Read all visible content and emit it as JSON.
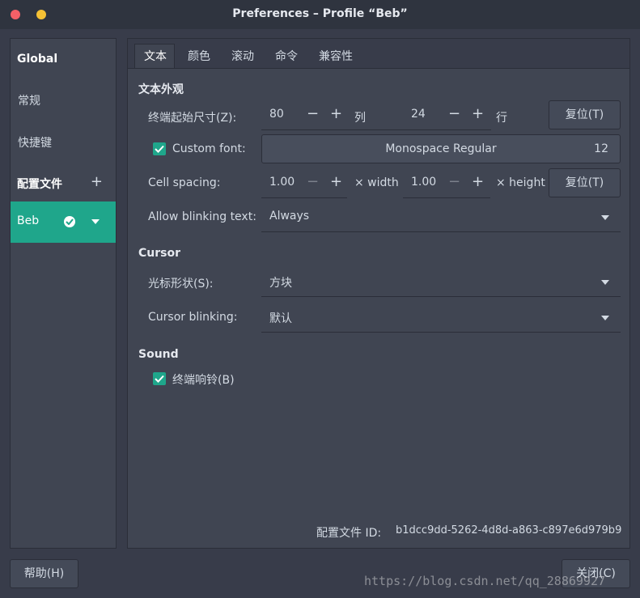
{
  "window": {
    "title": "Preferences – Profile “Beb”"
  },
  "sidebar": {
    "global": "Global",
    "general": "常规",
    "shortcuts": "快捷键",
    "profiles_header": "配置文件",
    "add_symbol": "+",
    "active_profile": "Beb"
  },
  "tabs": [
    "文本",
    "颜色",
    "滚动",
    "命令",
    "兼容性"
  ],
  "text_tab": {
    "appearance_header": "文本外观",
    "initial_size_label": "终端起始尺寸(Z):",
    "columns_value": "80",
    "columns_unit": "列",
    "rows_value": "24",
    "rows_unit": "行",
    "reset_label": "复位(T)",
    "custom_font_label": "Custom font:",
    "custom_font_checked": true,
    "font_name": "Monospace Regular",
    "font_size": "12",
    "cell_spacing_label": "Cell spacing:",
    "width_value": "1.00",
    "width_unit": "× width",
    "height_value": "1.00",
    "height_unit": "× height",
    "blink_text_label": "Allow blinking text:",
    "blink_text_value": "Always",
    "cursor_header": "Cursor",
    "cursor_shape_label": "光标形状(S):",
    "cursor_shape_value": "方块",
    "cursor_blink_label": "Cursor blinking:",
    "cursor_blink_value": "默认",
    "sound_header": "Sound",
    "bell_label": "终端响铃(B)",
    "bell_checked": true,
    "profile_id_label": "配置文件 ID:",
    "profile_id_value": "b1dcc9dd-5262-4d8d-a863-c897e6d979b9",
    "minus": "−",
    "plus": "+"
  },
  "footer": {
    "help_label": "帮助(H)",
    "close_label": "关闭(C)"
  },
  "watermark": "https://blog.csdn.net/qq_28869927",
  "colors": {
    "accent": "#1fa68b",
    "tab_indicator": "#5294e2",
    "background": "#383c4a"
  }
}
